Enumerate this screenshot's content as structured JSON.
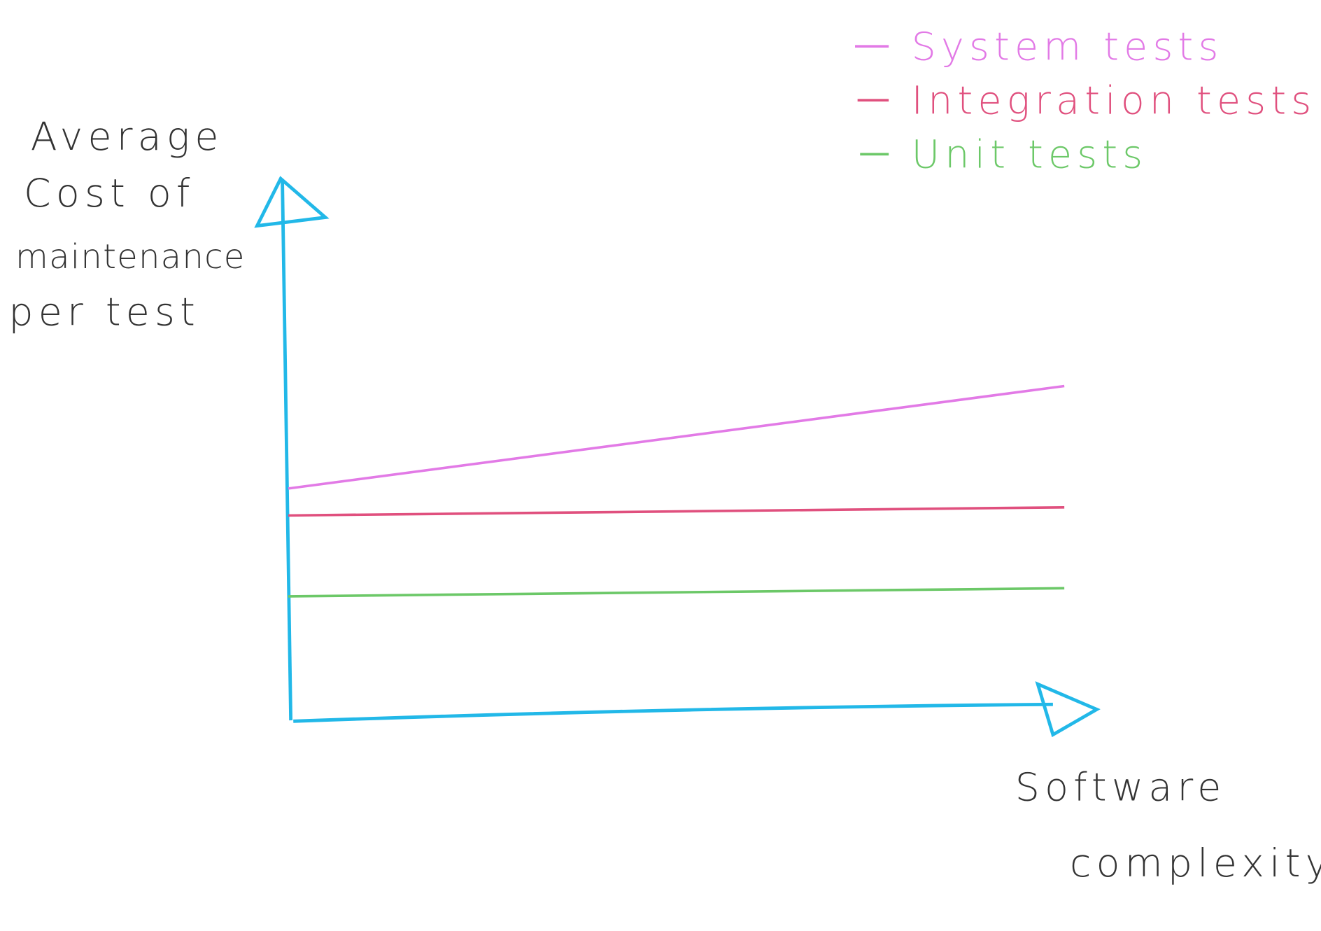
{
  "chart_data": {
    "type": "line",
    "title": "",
    "ylabel_lines": [
      "Average",
      "Cost of",
      "maintenance",
      "per test"
    ],
    "xlabel_lines": [
      "Software",
      "complexity"
    ],
    "xlim": [
      0,
      1
    ],
    "ylim": [
      0,
      1
    ],
    "grid": false,
    "legend_position": "top-right",
    "axis_color": "#22b8e8",
    "series": [
      {
        "name": "System tests",
        "color": "#e27ae6",
        "x": [
          0,
          0.95
        ],
        "y": [
          0.43,
          0.62
        ]
      },
      {
        "name": "Integration tests",
        "color": "#e0507e",
        "x": [
          0,
          0.95
        ],
        "y": [
          0.38,
          0.395
        ]
      },
      {
        "name": "Unit tests",
        "color": "#6cc868",
        "x": [
          0,
          0.95
        ],
        "y": [
          0.23,
          0.245
        ]
      }
    ]
  }
}
